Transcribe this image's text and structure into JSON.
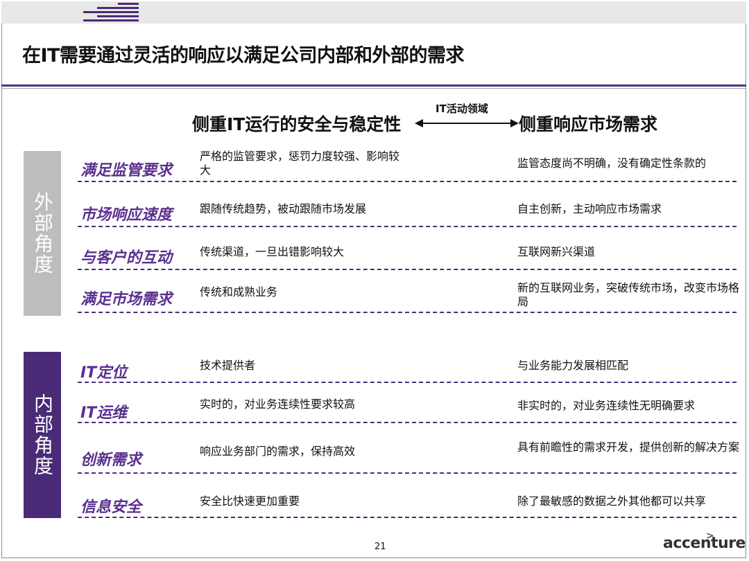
{
  "title": "在IT需要通过灵活的响应以满足公司内部和外部的需求",
  "header": {
    "left": "侧重IT运行的安全与稳定性",
    "middle": "IT活动领域",
    "right": "侧重响应市场需求"
  },
  "external": {
    "side_label": "外部角度",
    "rows": [
      {
        "label": "满足监管要求",
        "left": "严格的监管要求，惩罚力度较强、影响较大",
        "right": "监管态度尚不明确，没有确定性条款的"
      },
      {
        "label": "市场响应速度",
        "left": "跟随传统趋势，被动跟随市场发展",
        "right": "自主创新，主动响应市场需求"
      },
      {
        "label": "与客户的互动",
        "left": "传统渠道，一旦出错影响较大",
        "right": "互联网新兴渠道"
      },
      {
        "label": "满足市场需求",
        "left": "传统和成熟业务",
        "right": "新的互联网业务，突破传统市场，改变市场格局"
      }
    ]
  },
  "internal": {
    "side_label": "内部角度",
    "rows": [
      {
        "label": "IT定位",
        "left": "技术提供者",
        "right": "与业务能力发展相匹配"
      },
      {
        "label": "IT运维",
        "left": "实时的，对业务连续性要求较高",
        "right": "非实时的，对业务连续性无明确要求"
      },
      {
        "label": "创新需求",
        "left": "响应业务部门的需求，保持高效",
        "right": "具有前瞻性的需求开发，提供创新的解决方案"
      },
      {
        "label": "信息安全",
        "left": "安全比快速更加重要",
        "right": "除了最敏感的数据之外其他都可以共享"
      }
    ]
  },
  "footer": {
    "page_number": "21",
    "brand": "accenture",
    "brand_mark": ">"
  },
  "colors": {
    "accent_purple": "#4a2b78",
    "label_purple": "#5a2f8f",
    "side_gray": "#bdbdbd"
  }
}
